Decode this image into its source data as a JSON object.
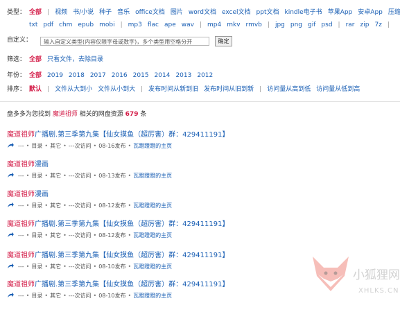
{
  "filters": {
    "type_label": "类型：",
    "type_row1": [
      "全部",
      "|",
      "视频",
      "书/小说",
      "种子",
      "音乐",
      "office文档",
      "图片",
      "word文档",
      "excel文档",
      "ppt文档",
      "kindle电子书",
      "苹果App",
      "安卓App",
      "压缩包"
    ],
    "type_row2": [
      "txt",
      "pdf",
      "chm",
      "epub",
      "mobi",
      "|",
      "mp3",
      "flac",
      "ape",
      "wav",
      "|",
      "mp4",
      "mkv",
      "rmvb",
      "|",
      "jpg",
      "png",
      "gif",
      "psd",
      "|",
      "rar",
      "zip",
      "7z",
      "|"
    ],
    "custom_label": "自定义：",
    "custom_placeholder": "输入自定义类型(内容仅限字母或数字)，多个类型用空格分开",
    "custom_button": "确定",
    "screen_label": "筛选：",
    "screen_items": [
      "全部",
      "只看文件，去除目录"
    ],
    "year_label": "年份：",
    "years": [
      "全部",
      "2019",
      "2018",
      "2017",
      "2016",
      "2015",
      "2014",
      "2013",
      "2012"
    ],
    "sort_label": "排序：",
    "sorts": [
      "默认",
      "|",
      "文件从大到小",
      "文件从小到大",
      "|",
      "发布时间从新到旧",
      "发布时间从旧到新",
      "|",
      "访问量从高到低",
      "访问量从低到高"
    ]
  },
  "summary": {
    "prefix": "盘多多为您找到",
    "keyword": "魔道祖师",
    "middle": "相关的网盘资源",
    "count": "679",
    "suffix": "条"
  },
  "results": [
    {
      "hl": "魔道祖师",
      "rest": "广播剧.第三季第九集【仙女摸鱼（超厉害）群：429411191】",
      "dash": "---",
      "dir": "目录",
      "cat": "其它",
      "visits": "---次访问",
      "date": "08-16发布",
      "owner": "瓦蹬蹬蹬的主页"
    },
    {
      "hl": "魔道祖师",
      "rest": "漫画",
      "dash": "---",
      "dir": "目录",
      "cat": "其它",
      "visits": "---次访问",
      "date": "08-13发布",
      "owner": "瓦蹬蹬蹬的主页"
    },
    {
      "hl": "魔道祖师",
      "rest": "漫画",
      "dash": "---",
      "dir": "目录",
      "cat": "其它",
      "visits": "---次访问",
      "date": "08-12发布",
      "owner": "瓦蹬蹬蹬的主页"
    },
    {
      "hl": "魔道祖师",
      "rest": "广播剧.第三季第九集【仙女摸鱼（超厉害）群：429411191】",
      "dash": "---",
      "dir": "目录",
      "cat": "其它",
      "visits": "---次访问",
      "date": "08-12发布",
      "owner": "瓦蹬蹬蹬的主页"
    },
    {
      "hl": "魔道祖师",
      "rest": "广播剧.第三季第九集【仙女摸鱼（超厉害）群：429411191】",
      "dash": "---",
      "dir": "目录",
      "cat": "其它",
      "visits": "---次访问",
      "date": "08-10发布",
      "owner": "瓦蹬蹬蹬的主页"
    },
    {
      "hl": "魔道祖师",
      "rest": "广播剧.第三季第九集【仙女摸鱼（超厉害）群：429411191】",
      "dash": "---",
      "dir": "目录",
      "cat": "其它",
      "visits": "---次访问",
      "date": "08-10发布",
      "owner": "瓦蹬蹬蹬的主页"
    }
  ],
  "watermark": {
    "title": "小狐狸网",
    "subtitle": "XHLKS.CN"
  },
  "colors": {
    "link": "#1a5fb4",
    "highlight": "#d4204b",
    "fox": "#f08a80"
  }
}
